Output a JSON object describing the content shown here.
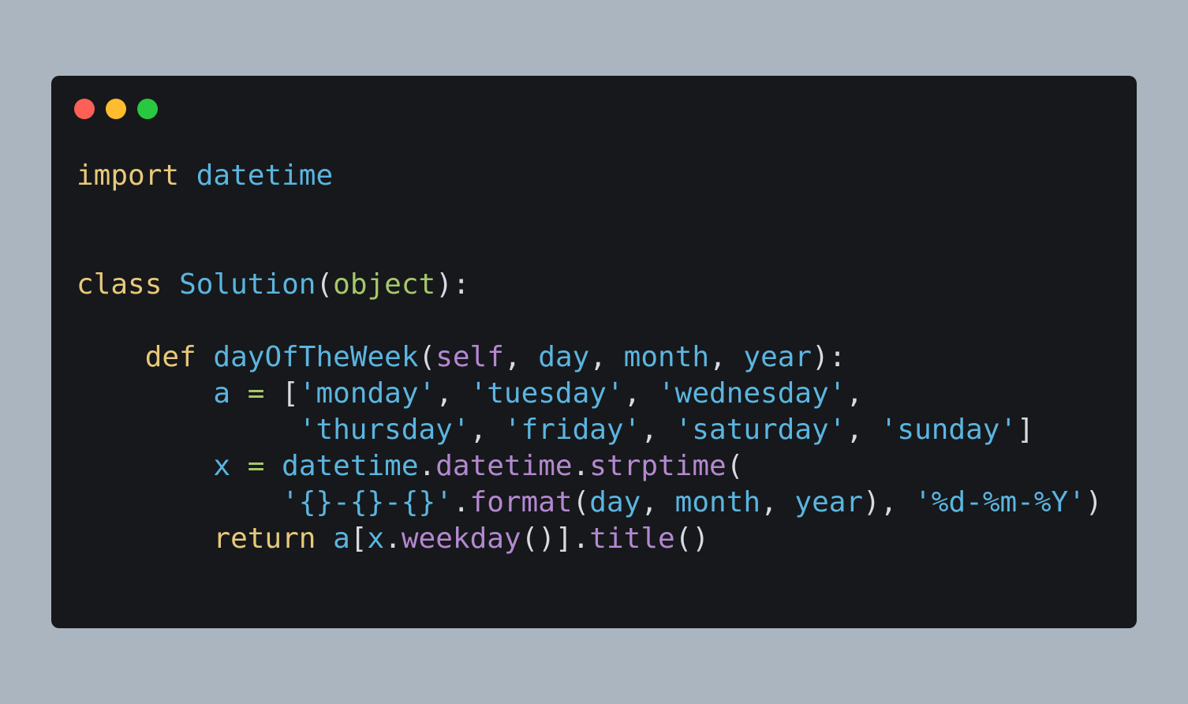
{
  "colors": {
    "background": "#abb5bf",
    "window": "#16181b",
    "dot_close": "#fe5f57",
    "dot_minimize": "#febc2e",
    "dot_maximize": "#29c840",
    "keyword": "#e8c97a",
    "name": "#5bb5e0",
    "builtin": "#a6c76a",
    "self": "#b488d0",
    "method": "#b488d0",
    "string": "#5bb5e0",
    "punct": "#d7dae0"
  },
  "window_controls": {
    "close_icon": "red-circle-icon",
    "minimize_icon": "yellow-circle-icon",
    "maximize_icon": "green-circle-icon"
  },
  "code": {
    "language": "python",
    "lines": [
      [
        {
          "text": "import",
          "type": "keyword"
        },
        {
          "text": " ",
          "type": "punct"
        },
        {
          "text": "datetime",
          "type": "name"
        }
      ],
      [],
      [],
      [
        {
          "text": "class",
          "type": "keyword"
        },
        {
          "text": " ",
          "type": "punct"
        },
        {
          "text": "Solution",
          "type": "name"
        },
        {
          "text": "(",
          "type": "punct"
        },
        {
          "text": "object",
          "type": "builtin"
        },
        {
          "text": "):",
          "type": "punct"
        }
      ],
      [],
      [
        {
          "text": "    ",
          "type": "punct"
        },
        {
          "text": "def",
          "type": "keyword"
        },
        {
          "text": " ",
          "type": "punct"
        },
        {
          "text": "dayOfTheWeek",
          "type": "name"
        },
        {
          "text": "(",
          "type": "punct"
        },
        {
          "text": "self",
          "type": "self"
        },
        {
          "text": ", ",
          "type": "punct"
        },
        {
          "text": "day",
          "type": "name"
        },
        {
          "text": ", ",
          "type": "punct"
        },
        {
          "text": "month",
          "type": "name"
        },
        {
          "text": ", ",
          "type": "punct"
        },
        {
          "text": "year",
          "type": "name"
        },
        {
          "text": "):",
          "type": "punct"
        }
      ],
      [
        {
          "text": "        ",
          "type": "punct"
        },
        {
          "text": "a",
          "type": "name"
        },
        {
          "text": " ",
          "type": "punct"
        },
        {
          "text": "=",
          "type": "builtin"
        },
        {
          "text": " [",
          "type": "punct"
        },
        {
          "text": "'monday'",
          "type": "string"
        },
        {
          "text": ", ",
          "type": "punct"
        },
        {
          "text": "'tuesday'",
          "type": "string"
        },
        {
          "text": ", ",
          "type": "punct"
        },
        {
          "text": "'wednesday'",
          "type": "string"
        },
        {
          "text": ",",
          "type": "punct"
        }
      ],
      [
        {
          "text": "             ",
          "type": "punct"
        },
        {
          "text": "'thursday'",
          "type": "string"
        },
        {
          "text": ", ",
          "type": "punct"
        },
        {
          "text": "'friday'",
          "type": "string"
        },
        {
          "text": ", ",
          "type": "punct"
        },
        {
          "text": "'saturday'",
          "type": "string"
        },
        {
          "text": ", ",
          "type": "punct"
        },
        {
          "text": "'sunday'",
          "type": "string"
        },
        {
          "text": "]",
          "type": "punct"
        }
      ],
      [
        {
          "text": "        ",
          "type": "punct"
        },
        {
          "text": "x",
          "type": "name"
        },
        {
          "text": " ",
          "type": "punct"
        },
        {
          "text": "=",
          "type": "builtin"
        },
        {
          "text": " ",
          "type": "punct"
        },
        {
          "text": "datetime",
          "type": "name"
        },
        {
          "text": ".",
          "type": "punct"
        },
        {
          "text": "datetime",
          "type": "method"
        },
        {
          "text": ".",
          "type": "punct"
        },
        {
          "text": "strptime",
          "type": "method"
        },
        {
          "text": "(",
          "type": "punct"
        }
      ],
      [
        {
          "text": "            ",
          "type": "punct"
        },
        {
          "text": "'{}-{}-{}'",
          "type": "string"
        },
        {
          "text": ".",
          "type": "punct"
        },
        {
          "text": "format",
          "type": "method"
        },
        {
          "text": "(",
          "type": "punct"
        },
        {
          "text": "day",
          "type": "name"
        },
        {
          "text": ", ",
          "type": "punct"
        },
        {
          "text": "month",
          "type": "name"
        },
        {
          "text": ", ",
          "type": "punct"
        },
        {
          "text": "year",
          "type": "name"
        },
        {
          "text": "), ",
          "type": "punct"
        },
        {
          "text": "'%d-%m-%Y'",
          "type": "string"
        },
        {
          "text": ")",
          "type": "punct"
        }
      ],
      [
        {
          "text": "        ",
          "type": "punct"
        },
        {
          "text": "return",
          "type": "keyword"
        },
        {
          "text": " ",
          "type": "punct"
        },
        {
          "text": "a",
          "type": "name"
        },
        {
          "text": "[",
          "type": "punct"
        },
        {
          "text": "x",
          "type": "name"
        },
        {
          "text": ".",
          "type": "punct"
        },
        {
          "text": "weekday",
          "type": "method"
        },
        {
          "text": "()].",
          "type": "punct"
        },
        {
          "text": "title",
          "type": "method"
        },
        {
          "text": "()",
          "type": "punct"
        }
      ]
    ]
  }
}
